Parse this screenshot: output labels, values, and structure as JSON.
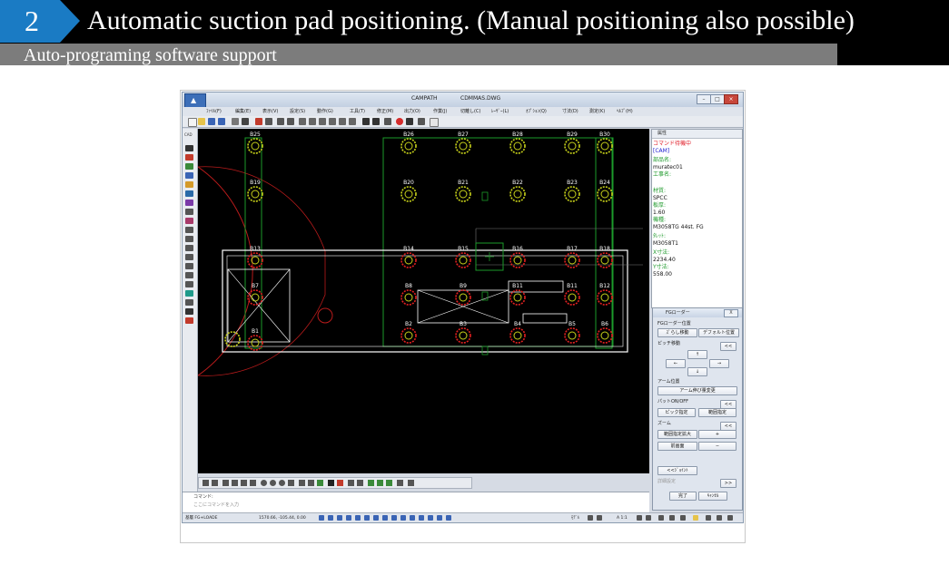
{
  "slide": {
    "number": "2",
    "title": "Automatic suction pad positioning. (Manual positioning also possible)",
    "subtitle": "Auto-programing software support",
    "badge_color": "#1a7bc4"
  },
  "window": {
    "title_left": "CAMPATH",
    "title_right": "CDMMAS.DWG"
  },
  "menu": [
    "ﾌｧｲﾙ(F)",
    "編集(E)",
    "表示(V)",
    "設定(S)",
    "動作(G)",
    "工具(T)",
    "修正(M)",
    "出力(O)",
    "作業(J)",
    "切離し(C)",
    "ﾚｰｻﾞｰ(L)",
    "ｵﾌﾟｼｮﾝ(Q)",
    "寸法(D)",
    "測定(K)",
    "ﾍﾙﾌﾟ(H)"
  ],
  "cad_label": "CAD",
  "pads": [
    {
      "label": "B25"
    },
    {
      "label": "B19"
    },
    {
      "label": "B13"
    },
    {
      "label": "B7"
    },
    {
      "label": "B1"
    },
    {
      "label": "B26"
    },
    {
      "label": "B27"
    },
    {
      "label": "B28"
    },
    {
      "label": "B29"
    },
    {
      "label": "B30"
    },
    {
      "label": "B20"
    },
    {
      "label": "B21"
    },
    {
      "label": "B22"
    },
    {
      "label": "B23"
    },
    {
      "label": "B24"
    },
    {
      "label": "B14"
    },
    {
      "label": "B15"
    },
    {
      "label": "B16"
    },
    {
      "label": "B17"
    },
    {
      "label": "B18"
    },
    {
      "label": "B8"
    },
    {
      "label": "B9"
    },
    {
      "label": "B11"
    },
    {
      "label": "B11"
    },
    {
      "label": "B12"
    },
    {
      "label": "B2"
    },
    {
      "label": "B3"
    },
    {
      "label": "B4"
    },
    {
      "label": "B5"
    },
    {
      "label": "B6"
    }
  ],
  "properties": {
    "header": "属性",
    "status": "コマンド待機中",
    "mode": "[CAM]",
    "part_name_label": "部品名:",
    "part_name_value": "muratec01",
    "process_label": "工事名:",
    "material_label": "材質:",
    "material_value": "SPCC",
    "thickness_label": "板厚:",
    "thickness_value": "1.60",
    "machine_label": "機種:",
    "machine_value": "M3058TG 44st. FG",
    "turret_label": "ﾀﾚｯﾄ:",
    "turret_value": "M3058T1",
    "x_size_label": "X寸法:",
    "x_size_value": "2234.40",
    "y_size_label": "Y寸法:",
    "y_size_value": "558.00"
  },
  "fg_panel": {
    "title": "FGローダー",
    "close": "X",
    "loader_pos_label": "FGローダー位置",
    "shift_move": "ｽﾞらし移動",
    "default_pos": "デフォルト位置",
    "pitch_label": "ピッチ移動",
    "collapse": "<<",
    "up": "↑",
    "left": "←",
    "right": "→",
    "down": "↓",
    "arm_label": "アーム位置",
    "arm_btn": "アーム伸び量変更",
    "pad_label": "パットON/OFF",
    "pick_btn": "ピック指定",
    "range_btn": "範囲指定",
    "zoom_label": "ズーム",
    "zoom_range": "範囲指定拡大",
    "zoom_in": "+",
    "prev_screen": "前画面",
    "zoom_out": "−",
    "joint_btn": "<<ｼﾞｮｲﾝﾄ",
    "detail_label": "詳細設定",
    "detail_btn": ">>",
    "ok_btn": "完了",
    "cancel_btn": "ｷｬﾝｾﾙ"
  },
  "command": {
    "label": "コマンド:",
    "placeholder": "ここにコマンドを入力"
  },
  "status": {
    "left": "基層 FG+LOADE",
    "coords": "1570.66, -105.44, 0.00",
    "model": "ﾓﾃﾞﾙ",
    "scale": "A 1:1"
  }
}
